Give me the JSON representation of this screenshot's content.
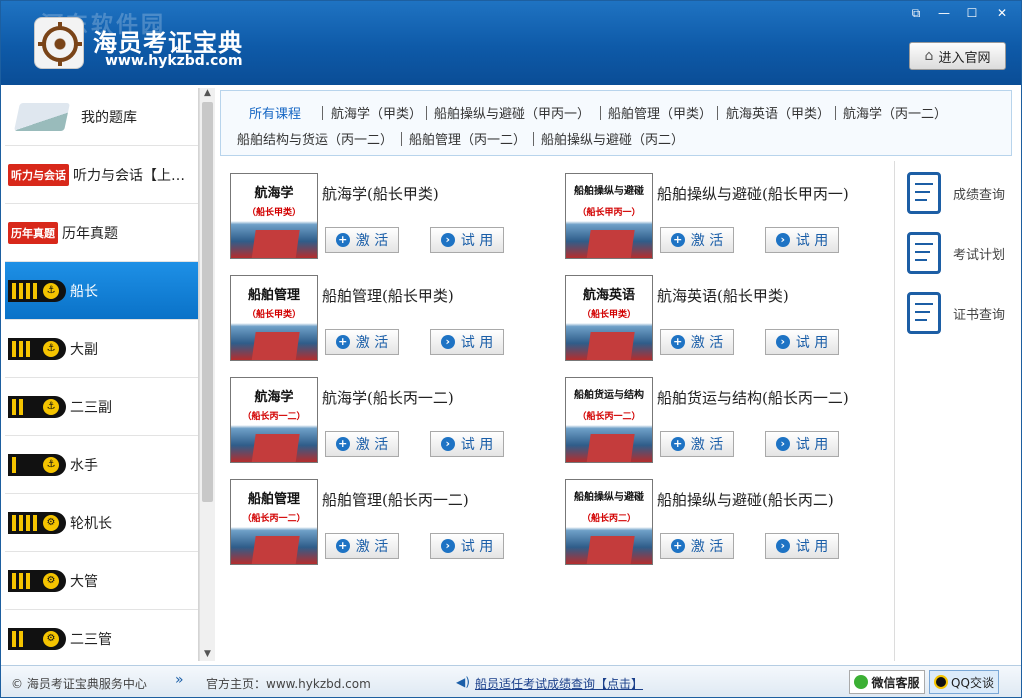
{
  "header": {
    "watermark": "河东软件园",
    "brand": "海员考证宝典",
    "site": "www.hykzbd.com",
    "official_button": "进入官网",
    "window_controls": {
      "restore": "⧉",
      "minimize": "—",
      "maximize": "☐",
      "close": "✕"
    }
  },
  "sidebar": {
    "my_bank": "我的题库",
    "items": [
      {
        "tag": "听力与会话",
        "label": "听力与会话【上…"
      },
      {
        "tag": "历年真题",
        "label": "历年真题"
      },
      {
        "label": "船长",
        "stripes": 4,
        "emblem": "⚓",
        "active": true
      },
      {
        "label": "大副",
        "stripes": 3,
        "emblem": "⚓"
      },
      {
        "label": "二三副",
        "stripes": 2,
        "emblem": "⚓"
      },
      {
        "label": "水手",
        "stripes": 1,
        "emblem": "⚓"
      },
      {
        "label": "轮机长",
        "stripes": 4,
        "emblem": "⚙"
      },
      {
        "label": "大管",
        "stripes": 3,
        "emblem": "⚙"
      },
      {
        "label": "二三管",
        "stripes": 2,
        "emblem": "⚙"
      }
    ]
  },
  "tabs": [
    "所有课程",
    "航海学（甲类）",
    "船舶操纵与避碰（甲丙一）",
    "船舶管理（甲类）",
    "航海英语（甲类）",
    "航海学（丙一二）",
    "船舶结构与货运（丙一二）",
    "船舶管理（丙一二）",
    "船舶操纵与避碰（丙二）"
  ],
  "courses": [
    {
      "cover": "航海学",
      "cover_sub": "（船长甲类）",
      "title": "航海学(船长甲类)"
    },
    {
      "cover": "船舶操纵与避碰",
      "cover_sub": "（船长甲丙一）",
      "title": "船舶操纵与避碰(船长甲丙一)"
    },
    {
      "cover": "船舶管理",
      "cover_sub": "（船长甲类）",
      "title": "船舶管理(船长甲类)"
    },
    {
      "cover": "航海英语",
      "cover_sub": "（船长甲类）",
      "title": "航海英语(船长甲类)"
    },
    {
      "cover": "航海学",
      "cover_sub": "（船长丙一二）",
      "title": "航海学(船长丙一二)"
    },
    {
      "cover": "船舶货运与结构",
      "cover_sub": "（船长丙一二）",
      "title": "船舶货运与结构(船长丙一二)"
    },
    {
      "cover": "船舶管理",
      "cover_sub": "（船长丙一二）",
      "title": "船舶管理(船长丙一二)"
    },
    {
      "cover": "船舶操纵与避碰",
      "cover_sub": "（船长丙二）",
      "title": "船舶操纵与避碰(船长丙二)"
    }
  ],
  "buttons": {
    "activate": "激 活",
    "trial": "试 用",
    "activate_icon": "+",
    "trial_icon": "›"
  },
  "right_panel": [
    "成绩查询",
    "考试计划",
    "证书查询"
  ],
  "status": {
    "copyright": "© 海员考证宝典服务中心",
    "expand": "»",
    "homepage": "官方主页：www.hykzbd.com",
    "notice": "船员适任考试成绩查询【点击】",
    "wechat": "微信客服",
    "qq": "QQ交谈"
  }
}
